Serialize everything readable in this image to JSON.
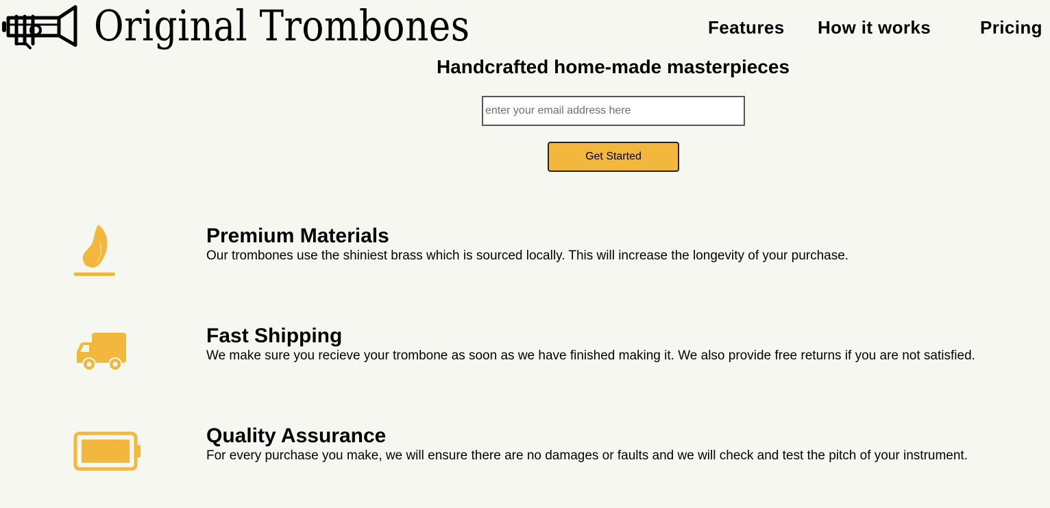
{
  "header": {
    "brand": "Original Trombones",
    "logo_icon": "trombone-logo-icon",
    "nav": [
      {
        "label": "Features"
      },
      {
        "label": "How it works"
      },
      {
        "label": "Pricing"
      }
    ]
  },
  "hero": {
    "title": "Handcrafted home-made masterpieces",
    "email_placeholder": "enter your email address here",
    "email_value": "",
    "cta_label": "Get Started"
  },
  "features": [
    {
      "icon": "fire-icon",
      "title": "Premium Materials",
      "description": "Our trombones use the shiniest brass which is sourced locally. This will increase the longevity of your purchase."
    },
    {
      "icon": "truck-icon",
      "title": "Fast Shipping",
      "description": "We make sure you recieve your trombone as soon as we have finished making it. We also provide free returns if you are not satisfied."
    },
    {
      "icon": "battery-full-icon",
      "title": "Quality Assurance",
      "description": "For every purchase you make, we will ensure there are no damages or faults and we will check and test the pitch of your instrument."
    }
  ],
  "colors": {
    "background": "#f7f7f2",
    "accent": "#f2b83e",
    "text": "#000000"
  }
}
